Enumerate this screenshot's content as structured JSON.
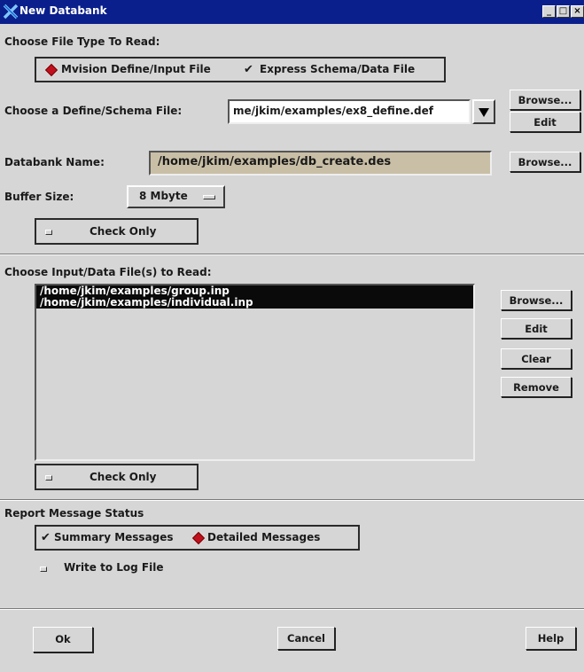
{
  "window": {
    "title": "New Databank"
  },
  "file_type": {
    "heading": "Choose File Type To Read:",
    "option_define": "Mvision Define/Input File",
    "option_express": "Express Schema/Data File",
    "selected": "Mvision Define/Input File"
  },
  "define_schema": {
    "label": "Choose a Define/Schema File:",
    "value": "me/jkim/examples/ex8_define.def",
    "browse": "Browse...",
    "edit": "Edit"
  },
  "databank": {
    "label": "Databank Name:",
    "value": "/home/jkim/examples/db_create.des",
    "browse": "Browse..."
  },
  "buffer": {
    "label": "Buffer Size:",
    "value": "8 Mbyte"
  },
  "check_only_1": {
    "label": "Check Only"
  },
  "input_files": {
    "heading": "Choose Input/Data File(s) to Read:",
    "items": [
      "/home/jkim/examples/group.inp",
      "/home/jkim/examples/individual.inp"
    ],
    "browse": "Browse...",
    "edit": "Edit",
    "clear": "Clear",
    "remove": "Remove"
  },
  "check_only_2": {
    "label": "Check Only"
  },
  "report": {
    "heading": "Report Message Status",
    "option_summary": "Summary Messages",
    "option_detailed": "Detailed Messages",
    "selected": "Detailed Messages",
    "write_log": "Write to Log File"
  },
  "footer": {
    "ok": "Ok",
    "cancel": "Cancel",
    "help": "Help"
  },
  "colors": {
    "titlebar": "#0a1f8c",
    "dialog_bg": "#d6d6d6",
    "field_tan": "#c9bfa6",
    "radio_selected": "#c0101e"
  }
}
